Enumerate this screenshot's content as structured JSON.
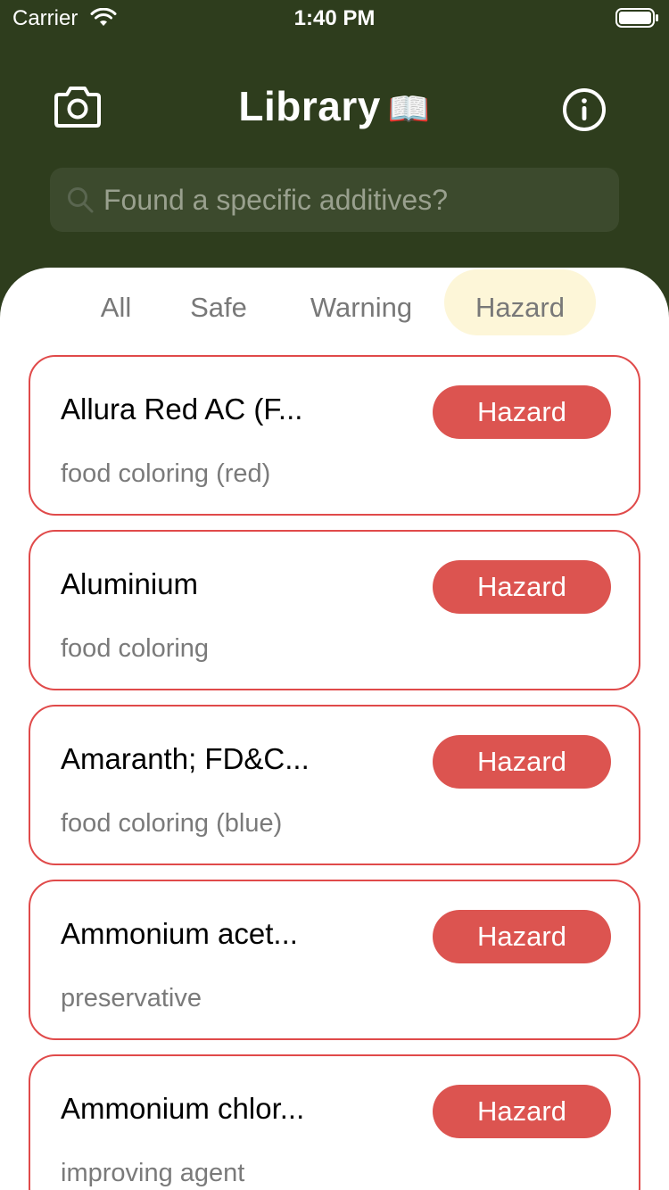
{
  "status_bar": {
    "carrier": "Carrier",
    "time": "1:40 PM"
  },
  "header": {
    "title": "Library",
    "title_emoji": "📖",
    "camera_icon": "camera-icon",
    "info_icon": "info-icon"
  },
  "search": {
    "placeholder": "Found a specific additives?",
    "value": ""
  },
  "tabs": [
    {
      "label": "All",
      "active": false
    },
    {
      "label": "Safe",
      "active": false
    },
    {
      "label": "Warning",
      "active": false
    },
    {
      "label": "Hazard",
      "active": true
    }
  ],
  "items": [
    {
      "name": "Allura Red AC (F...",
      "description": "food coloring (red)",
      "badge": "Hazard"
    },
    {
      "name": "Aluminium",
      "description": "food coloring",
      "badge": "Hazard"
    },
    {
      "name": "Amaranth; FD&C...",
      "description": "food coloring (blue)",
      "badge": "Hazard"
    },
    {
      "name": "Ammonium acet...",
      "description": "preservative",
      "badge": "Hazard"
    },
    {
      "name": "Ammonium chlor...",
      "description": "improving agent",
      "badge": "Hazard"
    }
  ],
  "colors": {
    "header_bg": "#2e3d1d",
    "search_bg": "#3c4a2d",
    "active_tab_bg": "#fdf6d8",
    "hazard_border": "#e04a4a",
    "hazard_badge": "#dc5450"
  }
}
